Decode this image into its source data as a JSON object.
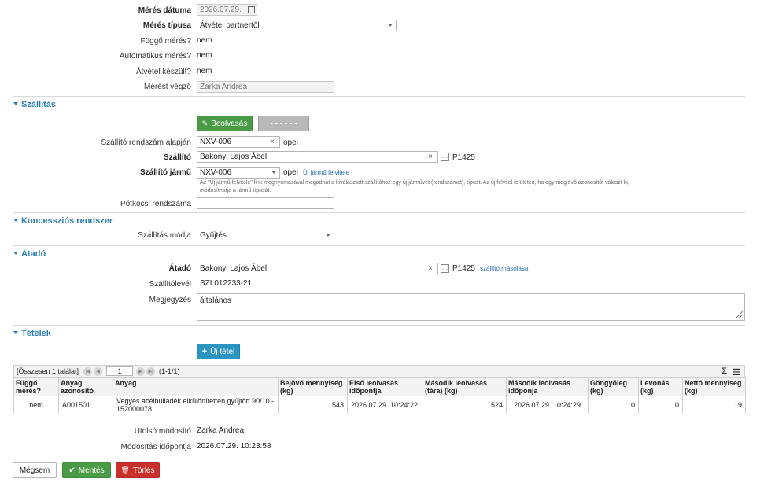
{
  "measurement": {
    "date_label": "Mérés dátuma",
    "date_value": "2026.07.29.",
    "type_label": "Mérés típusa",
    "type_value": "Átvétel partnertől",
    "pending_label": "Függő mérés?",
    "pending_value": "nem",
    "auto_label": "Automatikus mérés?",
    "auto_value": "nem",
    "receipt_label": "Átvétel készült?",
    "receipt_value": "nem",
    "operator_label": "Mérést végző",
    "operator_value": "Zarka Andrea"
  },
  "shipping": {
    "section_title": "Szállítás",
    "read_button": "Beolvasás",
    "dash_button": "- - - - - -",
    "plate_label": "Szállító rendszám alapján",
    "plate_value": "NXV-006",
    "plate_suffix": "opel",
    "carrier_label": "Szállító",
    "carrier_value": "Bakonyi Lajos Ábel",
    "carrier_code": "P1425",
    "vehicle_label": "Szállító jármű",
    "vehicle_value": "NXV-006",
    "vehicle_suffix": "opel",
    "new_vehicle_link": "Új jármű felvitele",
    "note_line1": "Az \"Új jármű felvitele\" link megnyomásával megadhat a kiválasztott szállítóhoz egy új járművet (rendszámot), típust. Az új felvitel felületen, ha egy meglévő azonosítót választ ki,",
    "note_line2": "módosíthatja a jármű típusát.",
    "trailer_label": "Pótkocsi rendszáma",
    "trailer_value": ""
  },
  "concession": {
    "section_title": "Koncessziós rendszer",
    "mode_label": "Szállítás módja",
    "mode_value": "Gyűjtés"
  },
  "handover": {
    "section_title": "Átadó",
    "giver_label": "Átadó",
    "giver_value": "Bakonyi Lajos Ábel",
    "giver_code": "P1425",
    "copy_link": "szállító másolása",
    "waybill_label": "Szállítólevél",
    "waybill_value": "SZL012233-21",
    "comment_label": "Megjegyzés",
    "comment_value": "általános"
  },
  "items": {
    "section_title": "Tételek",
    "new_item_button": "Új tétel",
    "total_label": "[Összesen 1 találat]",
    "page_value": "1",
    "page_range": "(1-1/1)",
    "sigma": "Σ",
    "columns": [
      "Függő mérés?",
      "Anyag azonosító",
      "Anyag",
      "Bejövő mennyiség (kg)",
      "Első leolvasás időpontja",
      "Második leolvasás (tára) (kg)",
      "Második leolvasás időponja",
      "Göngyöleg (kg)",
      "Levonás (kg)",
      "Nettó mennyiség (kg)"
    ],
    "rows": [
      {
        "pending": "nem",
        "material_id": "A001501",
        "material": "Vegyes acélhulladék elkülönítetten gyűjtött 90/10 - 152000078",
        "incoming": "543",
        "first_time": "2026.07.29. 10:24:22",
        "second": "524",
        "second_time": "2026.07.29. 10:24:29",
        "packaging": "0",
        "deduction": "0",
        "net": "19"
      }
    ]
  },
  "footer": {
    "modifier_label": "Utolsó módosító",
    "modifier_value": "Zarka Andrea",
    "modified_label": "Módosítás időpontja",
    "modified_value": "2026.07.29. 10:23:58",
    "cancel_button": "Mégsem",
    "save_button": "Mentés",
    "delete_button": "Törlés"
  }
}
